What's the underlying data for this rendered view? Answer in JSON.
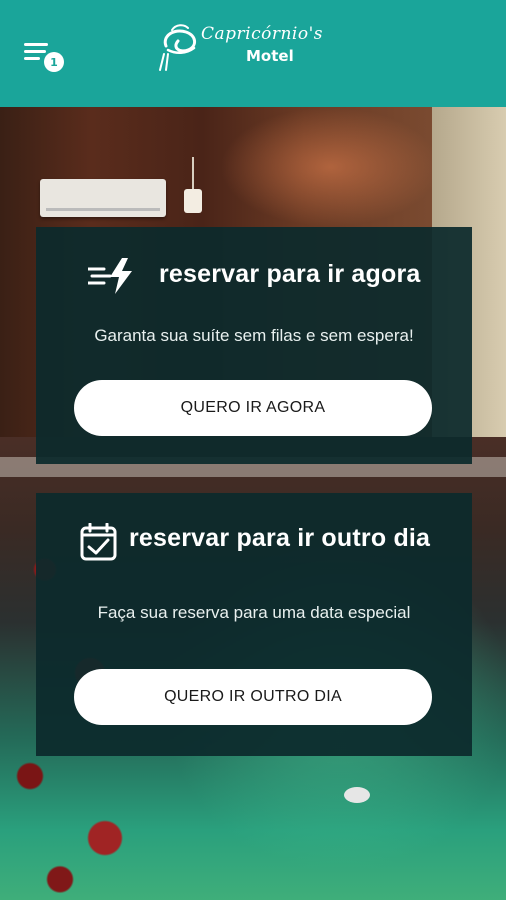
{
  "header": {
    "logo_script": "Capricórnio's",
    "logo_word": "Motel",
    "notification_count": "1",
    "menu_icon": "hamburger-menu-icon",
    "bg_color": "#1aa59a"
  },
  "cards": {
    "now": {
      "icon": "fast-lightning-icon",
      "title": "reservar para ir agora",
      "subtitle": "Garanta sua suíte sem filas e sem espera!",
      "button_label": "QUERO IR AGORA"
    },
    "later": {
      "icon": "calendar-check-icon",
      "title": "reservar para ir outro dia",
      "subtitle": "Faça sua reserva para uma data especial",
      "button_label": "QUERO IR OUTRO DIA"
    }
  }
}
